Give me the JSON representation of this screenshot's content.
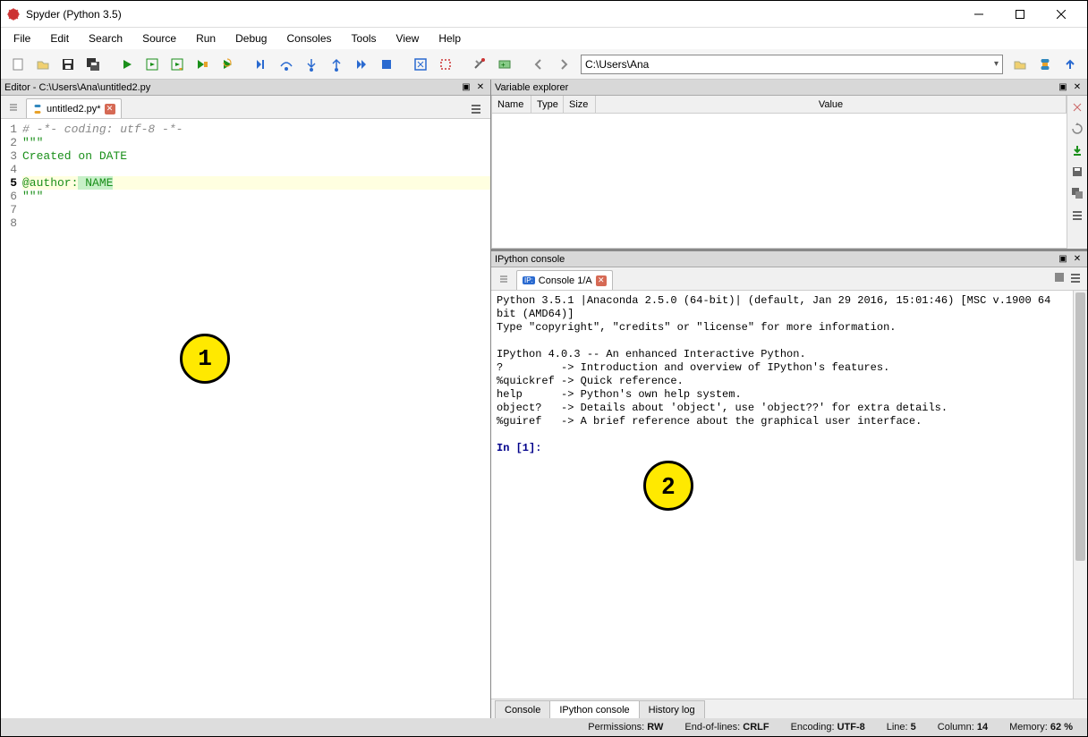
{
  "window": {
    "title": "Spyder (Python 3.5)"
  },
  "menu": [
    "File",
    "Edit",
    "Search",
    "Source",
    "Run",
    "Debug",
    "Consoles",
    "Tools",
    "View",
    "Help"
  ],
  "path_field": "C:\\Users\\Ana",
  "editor_pane": {
    "title": "Editor - C:\\Users\\Ana\\untitled2.py",
    "tab": "untitled2.py*",
    "lines": {
      "l1": "# -*- coding: utf-8 -*-",
      "l2": "\"\"\"",
      "l3": "Created on DATE",
      "l4": "",
      "l5a": "@author:",
      "l5b": " NAME",
      "l6": "\"\"\"",
      "l7": "",
      "l8": ""
    },
    "line_numbers": [
      "1",
      "2",
      "3",
      "4",
      "5",
      "6",
      "7",
      "8"
    ]
  },
  "variable_explorer": {
    "title": "Variable explorer",
    "cols": {
      "name": "Name",
      "type": "Type",
      "size": "Size",
      "value": "Value"
    }
  },
  "ipython": {
    "title": "IPython console",
    "tab": "Console 1/A",
    "text": "Python 3.5.1 |Anaconda 2.5.0 (64-bit)| (default, Jan 29 2016, 15:01:46) [MSC v.1900 64 bit (AMD64)]\nType \"copyright\", \"credits\" or \"license\" for more information.\n\nIPython 4.0.3 -- An enhanced Interactive Python.\n?         -> Introduction and overview of IPython's features.\n%quickref -> Quick reference.\nhelp      -> Python's own help system.\nobject?   -> Details about 'object', use 'object??' for extra details.\n%guiref   -> A brief reference about the graphical user interface.\n",
    "prompt": "In [1]: ",
    "bottom_tabs": [
      "Console",
      "IPython console",
      "History log"
    ]
  },
  "statusbar": {
    "perm_label": "Permissions:",
    "perm_val": "RW",
    "eol_label": "End-of-lines:",
    "eol_val": "CRLF",
    "enc_label": "Encoding:",
    "enc_val": "UTF-8",
    "line_label": "Line:",
    "line_val": "5",
    "col_label": "Column:",
    "col_val": "14",
    "mem_label": "Memory:",
    "mem_val": "62 %"
  },
  "callouts": {
    "one": "1",
    "two": "2"
  }
}
